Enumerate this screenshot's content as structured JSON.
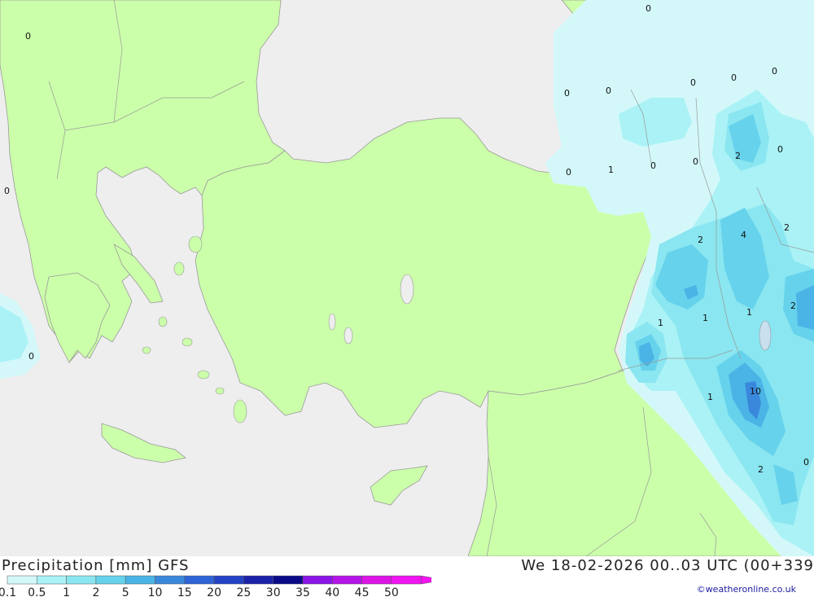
{
  "header": {
    "title_left": "Precipitation [mm] GFS",
    "title_right": "We 18-02-2026 00..03 UTC (00+339"
  },
  "footer": {
    "copyright": "©weatheronline.co.uk"
  },
  "colors": {
    "sea": "#eeeeee",
    "land": "#ccffaa",
    "border": "#999999",
    "precip_01": "#d4f8fa",
    "precip_05": "#aaf2f6",
    "precip_1": "#8ae6f0",
    "precip_2": "#66d2ec",
    "precip_5": "#4ab4e6",
    "precip_10": "#3a88dc"
  },
  "legend": {
    "labels": [
      "0.1",
      "0.5",
      "1",
      "2",
      "5",
      "10",
      "15",
      "20",
      "25",
      "30",
      "35",
      "40",
      "45",
      "50"
    ],
    "colors": [
      "#d4f8fa",
      "#aaf2f6",
      "#8ae6f0",
      "#66d2ec",
      "#4ab4e6",
      "#3a88dc",
      "#2e64d6",
      "#2442c4",
      "#1a22aa",
      "#0a0a88",
      "#8a14e6",
      "#b414e6",
      "#dc14e6",
      "#f014f0"
    ]
  },
  "map_values": [
    {
      "text": "0"
    },
    {
      "text": "0"
    },
    {
      "text": "0"
    },
    {
      "text": "0"
    },
    {
      "text": "0"
    },
    {
      "text": "0"
    },
    {
      "text": "0"
    },
    {
      "text": "0"
    },
    {
      "text": "0"
    },
    {
      "text": "1"
    },
    {
      "text": "0"
    },
    {
      "text": "0"
    },
    {
      "text": "2"
    },
    {
      "text": "0"
    },
    {
      "text": "2"
    },
    {
      "text": "4"
    },
    {
      "text": "2"
    },
    {
      "text": "1"
    },
    {
      "text": "1"
    },
    {
      "text": "1"
    },
    {
      "text": "2"
    },
    {
      "text": "1"
    },
    {
      "text": "10"
    },
    {
      "text": "2"
    },
    {
      "text": "0"
    }
  ]
}
